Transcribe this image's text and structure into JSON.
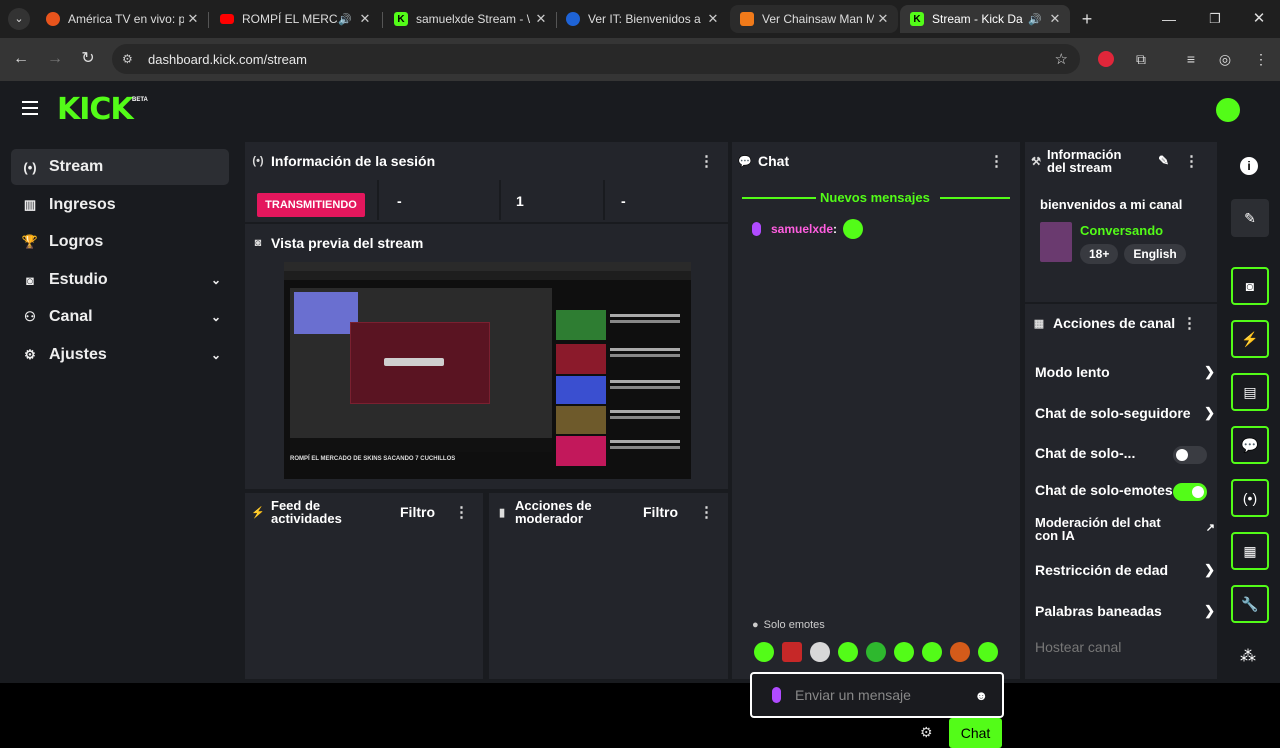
{
  "browser": {
    "tabs": [
      {
        "title": "América TV en vivo: p",
        "favicon_color": "#e8541c"
      },
      {
        "title": "ROMPÍ EL MERCA",
        "favicon_color": "#ff0000"
      },
      {
        "title": "samuelxde Stream - \\",
        "favicon_color": "#53fc18"
      },
      {
        "title": "Ver IT: Bienvenidos a",
        "favicon_color": "#1e63d6"
      },
      {
        "title": "Ver Chainsaw Man M",
        "favicon_color": "#f07a1a"
      },
      {
        "title": "Stream - Kick Da",
        "favicon_color": "#53fc18"
      }
    ],
    "url": "dashboard.kick.com/stream",
    "close": "✕",
    "new_tab": "+"
  },
  "kick": {
    "logo": "KICK",
    "beta": "BETA",
    "sidebar": [
      {
        "label": "Stream",
        "icon": "broadcast-icon",
        "glyph": "(•)"
      },
      {
        "label": "Ingresos",
        "icon": "bar-chart-icon",
        "glyph": "▥"
      },
      {
        "label": "Logros",
        "icon": "trophy-icon",
        "glyph": "🏆"
      },
      {
        "label": "Estudio",
        "icon": "studio-icon",
        "glyph": "◙"
      },
      {
        "label": "Canal",
        "icon": "channel-icon",
        "glyph": "⚇"
      },
      {
        "label": "Ajustes",
        "icon": "gear-icon",
        "glyph": "⚙"
      }
    ],
    "session": {
      "title": "Información de la sesión",
      "status": "TRANSMITIENDO",
      "stat1": "-",
      "stat2": "1",
      "stat3": "-"
    },
    "preview": {
      "title": "Vista previa del stream",
      "video_title": "ROMPÍ EL MERCADO DE SKINS SACANDO 7 CUCHILLOS"
    },
    "feed": {
      "title_line1": "Feed de",
      "title_line2": "actividades",
      "filter": "Filtro"
    },
    "mod": {
      "title_line1": "Acciones de",
      "title_line2": "moderador",
      "filter": "Filtro"
    },
    "chat": {
      "title": "Chat",
      "new_messages": "Nuevos mensajes",
      "messages": [
        {
          "user": "samuelxde",
          "separator": ":"
        }
      ],
      "emote_mode": "Solo emotes",
      "input_placeholder": "Enviar un mensaje",
      "send_button": "Chat"
    },
    "stream_info": {
      "title_line1": "Información",
      "title_line2": "del stream",
      "stream_title": "bienvenidos a mi canal",
      "category": "Conversando",
      "tags": [
        "18+",
        "English"
      ]
    },
    "channel_actions": {
      "title": "Acciones de canal",
      "items": [
        {
          "label": "Modo lento",
          "type": "link"
        },
        {
          "label": "Chat de solo-seguidore",
          "type": "link"
        },
        {
          "label": "Chat de solo-...",
          "type": "toggle",
          "on": false
        },
        {
          "label": "Chat de solo-emotes",
          "type": "toggle",
          "on": true
        },
        {
          "label_line1": "Moderación del chat",
          "label_line2": "con IA",
          "type": "external"
        },
        {
          "label": "Restricción de edad",
          "type": "link"
        },
        {
          "label": "Palabras baneadas",
          "type": "link"
        },
        {
          "label": "Hostear canal",
          "type": "disabled"
        }
      ]
    },
    "colors": {
      "accent": "#53fc18",
      "live": "#e4175d",
      "username": "#ff5ee0"
    }
  }
}
